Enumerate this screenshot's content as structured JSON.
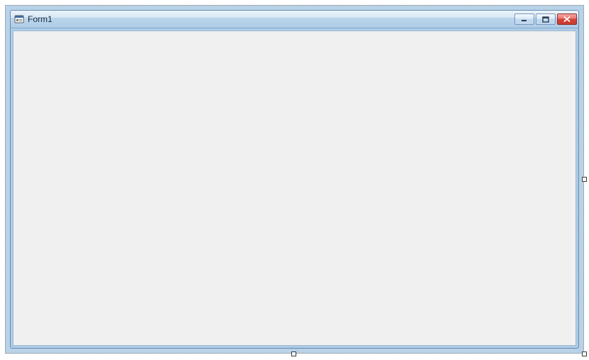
{
  "window": {
    "title": "Form1",
    "icons": {
      "app": "app-icon",
      "minimize": "minimize-icon",
      "maximize": "maximize-icon",
      "close": "close-icon"
    }
  }
}
